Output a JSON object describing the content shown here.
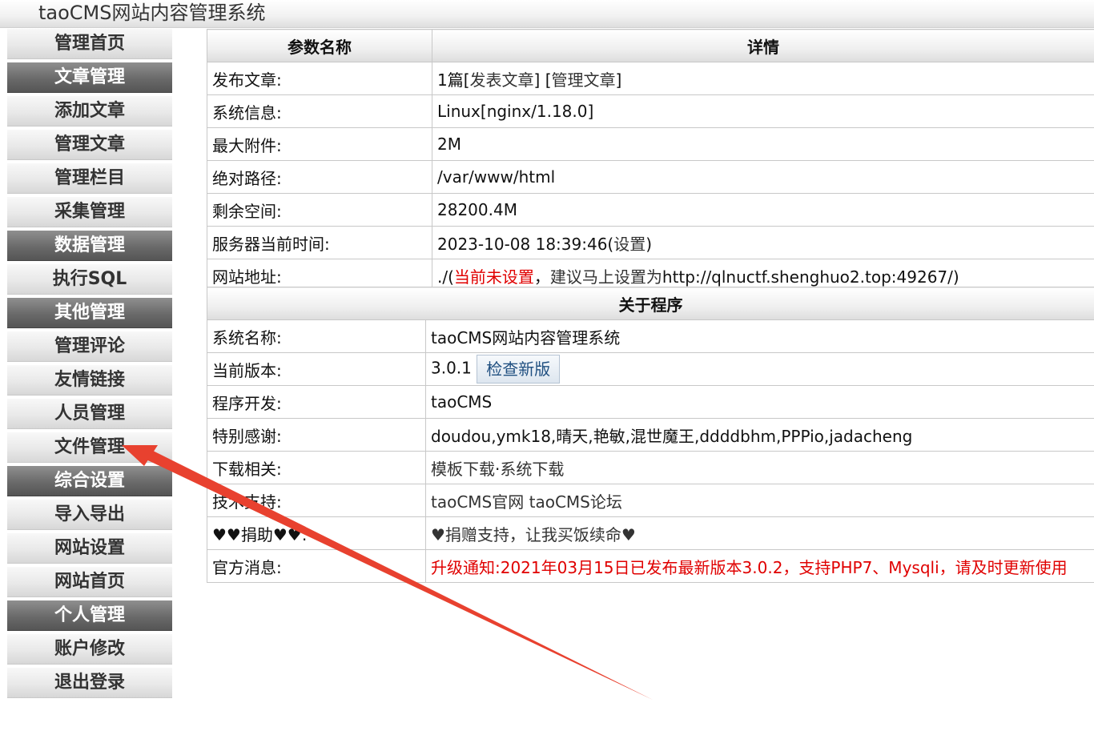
{
  "header": {
    "title": "taoCMS网站内容管理系统"
  },
  "sidebar": {
    "items": [
      {
        "label": "管理首页",
        "section": false
      },
      {
        "label": "文章管理",
        "section": true
      },
      {
        "label": "添加文章",
        "section": false
      },
      {
        "label": "管理文章",
        "section": false
      },
      {
        "label": "管理栏目",
        "section": false
      },
      {
        "label": "采集管理",
        "section": false
      },
      {
        "label": "数据管理",
        "section": true
      },
      {
        "label": "执行SQL",
        "section": false
      },
      {
        "label": "其他管理",
        "section": true
      },
      {
        "label": "管理评论",
        "section": false
      },
      {
        "label": "友情链接",
        "section": false
      },
      {
        "label": "人员管理",
        "section": false
      },
      {
        "label": "文件管理",
        "section": false
      },
      {
        "label": "综合设置",
        "section": true
      },
      {
        "label": "导入导出",
        "section": false
      },
      {
        "label": "网站设置",
        "section": false
      },
      {
        "label": "网站首页",
        "section": false
      },
      {
        "label": "个人管理",
        "section": true
      },
      {
        "label": "账户修改",
        "section": false
      },
      {
        "label": "退出登录",
        "section": false
      }
    ]
  },
  "params": {
    "header_name": "参数名称",
    "header_detail": "详情",
    "publish_label": "发布文章:",
    "publish_count": "1篇",
    "publish_link_open": "[",
    "publish_post_link": "发表文章",
    "publish_mid": "] [",
    "publish_manage_link": "管理文章",
    "publish_close": "]",
    "sysinfo_label": "系统信息:",
    "sysinfo_value": "Linux[nginx/1.18.0]",
    "maxattach_label": "最大附件:",
    "maxattach_value": "2M",
    "abspath_label": "绝对路径:",
    "abspath_value": "/var/www/html",
    "space_label": "剩余空间:",
    "space_value": "28200.4M",
    "time_label": "服务器当前时间:",
    "time_value": "2023-10-08 18:39:46",
    "time_open": "(",
    "time_link": "设置",
    "time_close": ")",
    "url_label": "网站地址:",
    "url_prefix": "./(",
    "url_unset": "当前未设置",
    "url_comma": "，",
    "url_suggest_link": "建议马上设置为",
    "url_suggest_value": "http://qlnuctf.shenghuo2.top:49267/",
    "url_close": ")"
  },
  "about": {
    "title": "关于程序",
    "name_label": "系统名称:",
    "name_value": "taoCMS网站内容管理系统",
    "version_label": "当前版本:",
    "version_value": "3.0.1",
    "check_button": "检查新版",
    "dev_label": "程序开发:",
    "dev_value": "taoCMS",
    "thanks_label": "特别感谢:",
    "thanks_value": "doudou,ymk18,晴天,艳敏,混世魔王,ddddbhm,PPPio,jadacheng",
    "download_label": "下载相关:",
    "download_template": "模板下载",
    "download_sep": "·",
    "download_system": "系统下载",
    "support_label": "技术支持:",
    "support_site": "taoCMS官网",
    "support_forum": "taoCMS论坛",
    "donate_label": "♥♥捐助♥♥:",
    "donate_value": "♥捐赠支持，让我买饭续命♥",
    "news_label": "官方消息:",
    "news_value": "升级通知:2021年03月15日已发布最新版本3.0.2，支持PHP7、Mysqli，请及时更新使用"
  },
  "colors": {
    "accent_red": "#e00000",
    "section_bg": "#6a6a6a",
    "annotation_arrow": "#e8412f"
  }
}
